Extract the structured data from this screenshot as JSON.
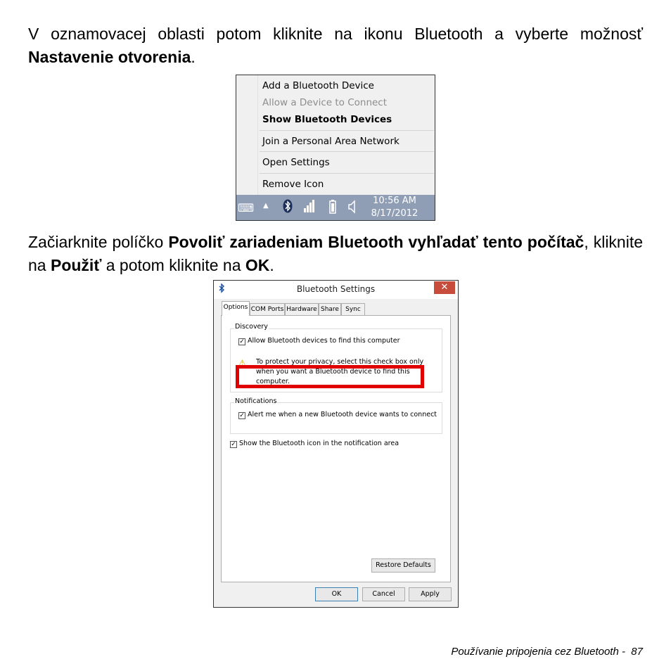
{
  "instructions": {
    "step1": {
      "text_before": "V oznamovacej oblasti potom kliknite na ikonu Bluetooth a vyberte možnosť ",
      "bold_action": "Nastavenie otvorenia",
      "text_after": "."
    },
    "step2": {
      "text_before": "Začiarknite políčko ",
      "bold_option": "Povoliť zariadeniam Bluetooth vyhľadať tento počítač",
      "text_middle": ", kliknite na ",
      "bold_apply": "Použiť",
      "text_middle2": " a potom kliknite na ",
      "bold_ok": "OK",
      "text_after": "."
    }
  },
  "context_menu": {
    "items": [
      {
        "label": "Add a Bluetooth Device",
        "state": "normal"
      },
      {
        "label": "Allow a Device to Connect",
        "state": "disabled"
      },
      {
        "label": "Show Bluetooth Devices",
        "state": "bold"
      },
      {
        "label": "Join a Personal Area Network",
        "state": "normal"
      },
      {
        "label": "Open Settings",
        "state": "normal"
      },
      {
        "label": "Remove Icon",
        "state": "normal"
      }
    ],
    "taskbar": {
      "time": "10:56 AM",
      "date": "8/17/2012",
      "icons": [
        "keyboard-icon",
        "chevron-up-icon",
        "bluetooth-icon",
        "network-icon",
        "battery-icon",
        "volume-icon"
      ],
      "color": "#8f9db5"
    }
  },
  "dialog": {
    "title": "Bluetooth Settings",
    "close_glyph": "✕",
    "tabs": [
      "Options",
      "COM Ports",
      "Hardware",
      "Share",
      "Sync"
    ],
    "active_tab": "Options",
    "discovery": {
      "label": "Discovery",
      "allow_checkbox": {
        "label": "Allow Bluetooth devices to find this computer",
        "checked": true
      },
      "warning": [
        "To protect your privacy, select this check box only",
        "when you want a Bluetooth device to find this",
        "computer."
      ]
    },
    "notifications": {
      "label": "Notifications",
      "alert_checkbox": {
        "label": "Alert me when a new Bluetooth device wants to connect",
        "checked": true
      }
    },
    "show_icon_checkbox": {
      "label": "Show the Bluetooth icon in the notification area",
      "checked": true
    },
    "buttons": {
      "restore_defaults": "Restore Defaults",
      "ok": "OK",
      "cancel": "Cancel",
      "apply": "Apply"
    },
    "highlight_color": "#e10000"
  },
  "footer": {
    "text": "Používanie pripojenia cez Bluetooth -  87"
  }
}
